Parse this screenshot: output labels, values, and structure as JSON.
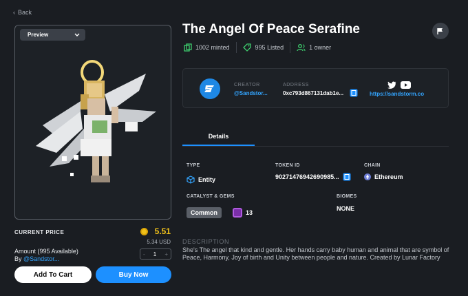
{
  "nav": {
    "back_label": "Back"
  },
  "preview": {
    "dropdown_label": "Preview"
  },
  "pricing": {
    "label": "CURRENT PRICE",
    "price": "5.51",
    "usd": "5.34 USD",
    "amount": "Amount (995 Available)",
    "by_prefix": "By",
    "by_user": "@Sandstor...",
    "quantity": "1",
    "decrement": "-",
    "increment": "+",
    "add_to_cart": "Add To Cart",
    "buy_now": "Buy Now"
  },
  "asset": {
    "title": "The Angel Of Peace Serafine",
    "minted": "1002 minted",
    "listed": "995 Listed",
    "owners": "1 owner"
  },
  "creator": {
    "creator_label": "CREATOR",
    "creator_name": "@Sandstor...",
    "address_label": "ADDRESS",
    "address": "0xc793d867131dab1e...",
    "website": "https://sandstorm.co"
  },
  "tabs": {
    "details": "Details"
  },
  "details": {
    "type_label": "TYPE",
    "type_value": "Entity",
    "token_label": "TOKEN ID",
    "token_value": "90271476942690985...",
    "chain_label": "CHAIN",
    "chain_value": "Ethereum",
    "catalyst_label": "CATALYST & GEMS",
    "catalyst_value": "Common",
    "gem_count": "13",
    "biomes_label": "BIOMES",
    "biomes_value": "NONE"
  },
  "description": {
    "label": "DESCRIPTION",
    "text": "She's The angel that kind and gentle. Her hands carry baby human and animal that are symbol of Peace, Harmony, Joy of birth and Unity between people and nature. Created by Lunar Factory"
  },
  "colors": {
    "accent": "#1d90ff",
    "price": "#f0c11a",
    "link": "#33a5ff",
    "background": "#1a1d22"
  }
}
